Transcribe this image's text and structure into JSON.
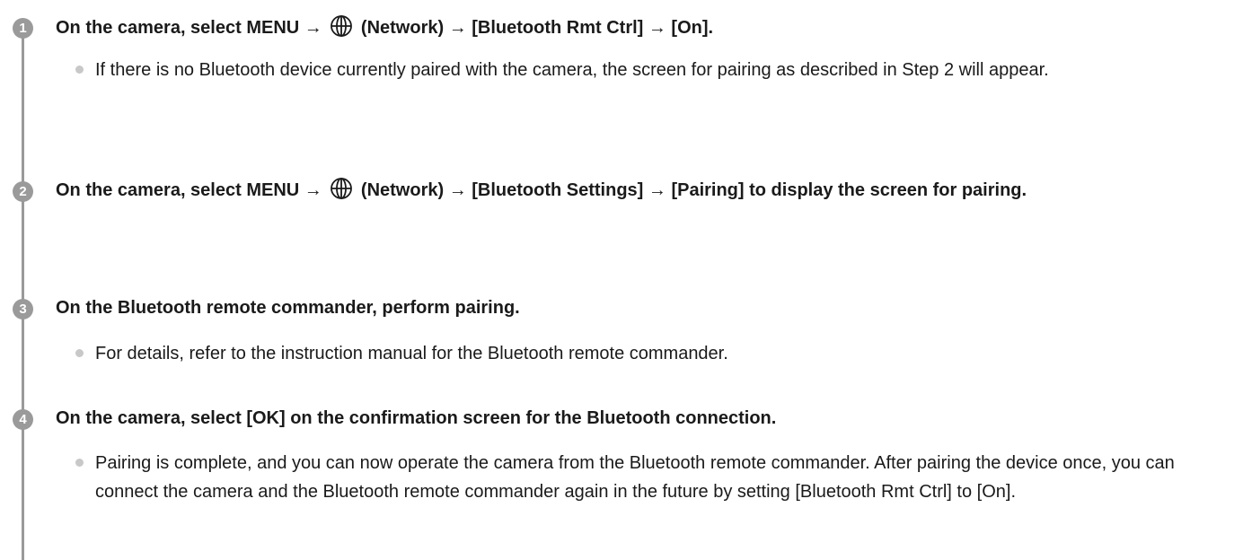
{
  "steps": [
    {
      "number": "1",
      "heading_before": "On the camera, select MENU →",
      "icon": "network-globe-icon",
      "heading_after": "(Network) → [Bluetooth Rmt Ctrl] → [On].",
      "note": "If there is no Bluetooth device currently paired with the camera, the screen for pairing as described in Step 2 will appear."
    },
    {
      "number": "2",
      "heading_before": "On the camera, select MENU →",
      "icon": "network-globe-icon",
      "heading_after": "(Network) → [Bluetooth Settings] → [Pairing] to display the screen for pairing."
    },
    {
      "number": "3",
      "heading": "On the Bluetooth remote commander, perform pairing.",
      "note": "For details, refer to the instruction manual for the Bluetooth remote commander."
    },
    {
      "number": "4",
      "heading": "On the camera, select [OK] on the confirmation screen for the Bluetooth connection.",
      "note": "Pairing is complete, and you can now operate the camera from the Bluetooth remote commander. After pairing the device once, you can connect the camera and the Bluetooth remote commander again in the future by setting [Bluetooth Rmt Ctrl] to [On]."
    }
  ],
  "colors": {
    "badge": "#9a9a9a",
    "rail": "#9a9a9a",
    "bullet_dot": "#c8c8c8",
    "text": "#1a1a1a"
  }
}
